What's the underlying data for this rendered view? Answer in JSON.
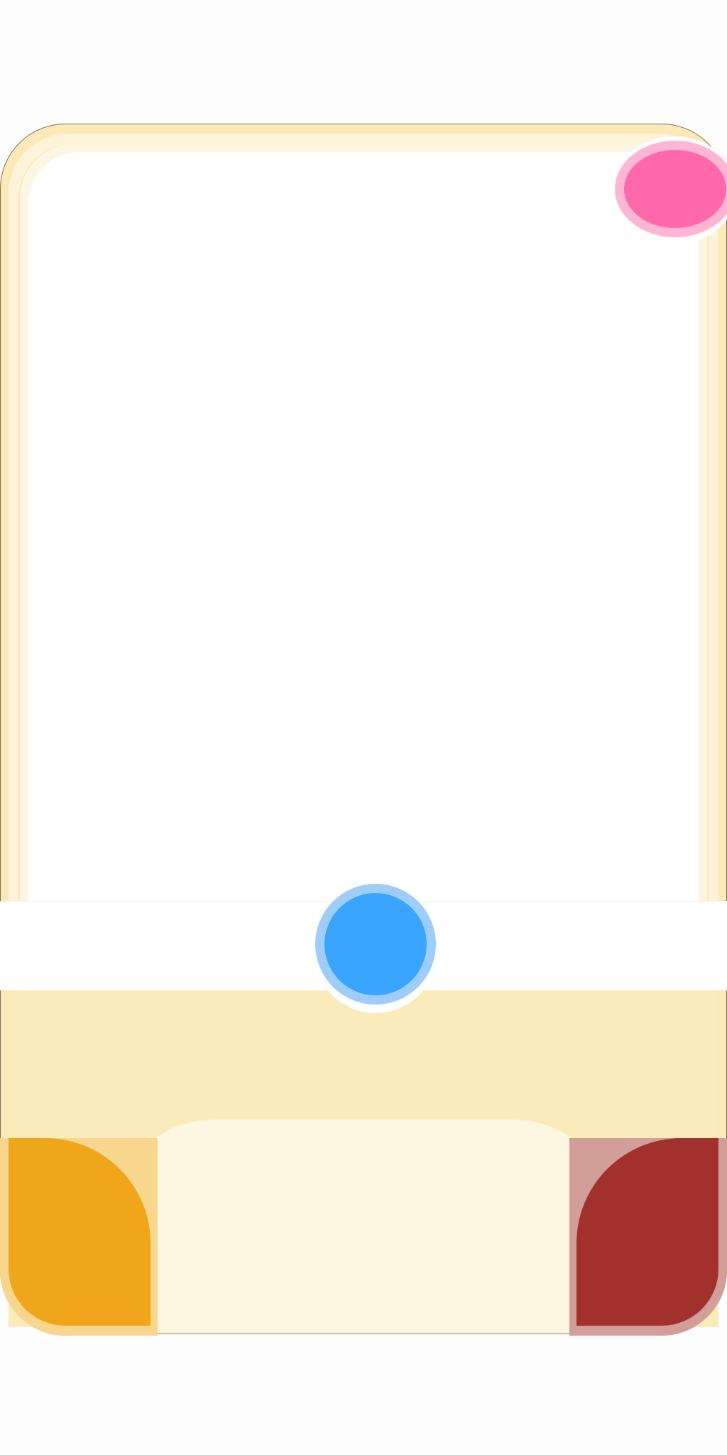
{
  "game": {
    "board": {
      "frame_color": "#fbe9b8",
      "frame_inner_color": "#fdf3d8",
      "playfield_color": "#ffffff",
      "lower_area_color": "#faecba",
      "goal_zone_color": "#fdf6e1"
    },
    "corners": {
      "left": {
        "color": "#f0a61a",
        "rim_color": "#f8d68e"
      },
      "right": {
        "color": "#a2312e",
        "rim_color": "#d29e98"
      }
    },
    "tokens": {
      "pink": {
        "core_color": "#ff69ab",
        "ring_color": "#ffb6d5",
        "icon": "pink-puck"
      },
      "blue": {
        "core_color": "#39a5ff",
        "ring_color": "#9dcdf8",
        "icon": "blue-puck"
      }
    }
  }
}
